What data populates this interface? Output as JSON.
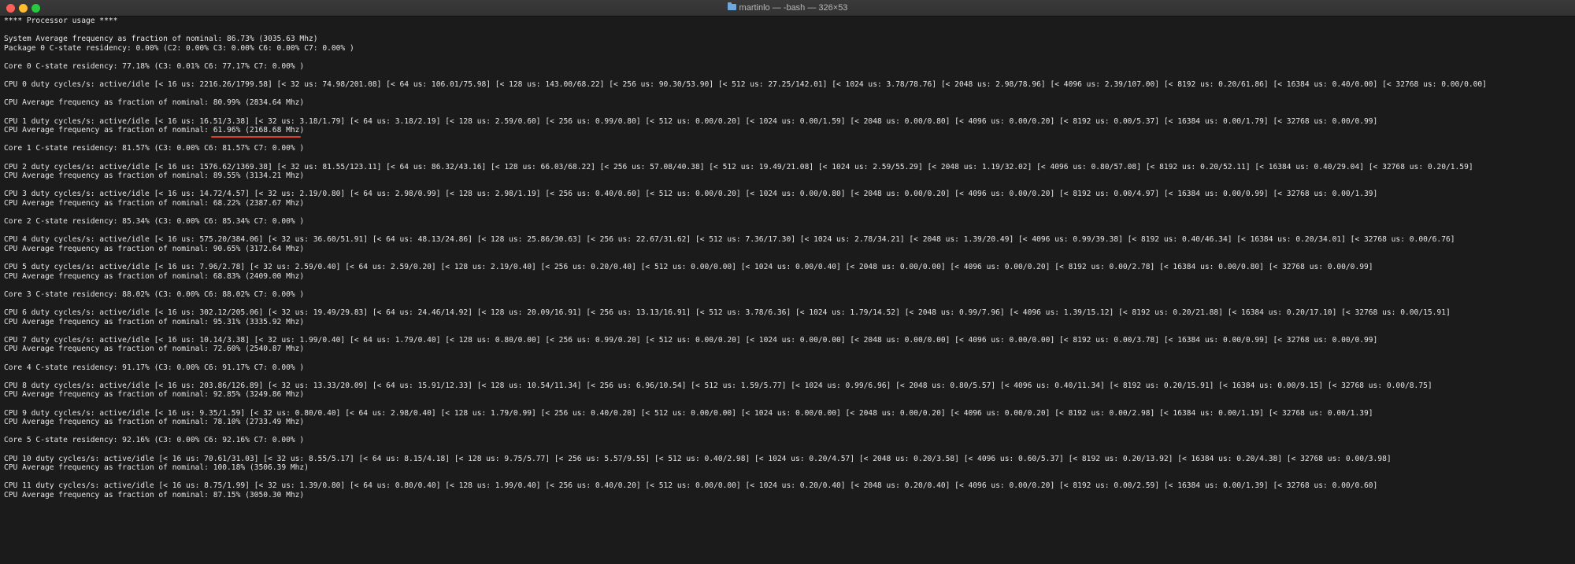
{
  "window": {
    "title": "martinlo — -bash — 326×53"
  },
  "colors": {
    "background": "#1b1b1b",
    "text": "#e6e6e6",
    "annotation": "#e0402a"
  },
  "terminal": {
    "lines": [
      "**** Processor usage ****",
      "",
      "System Average frequency as fraction of nominal: 86.73% (3035.63 Mhz)",
      "Package 0 C-state residency: 0.00% (C2: 0.00% C3: 0.00% C6: 0.00% C7: 0.00% )",
      "",
      "Core 0 C-state residency: 77.18% (C3: 0.01% C6: 77.17% C7: 0.00% )",
      "",
      "CPU 0 duty cycles/s: active/idle [< 16 us: 2216.26/1799.58] [< 32 us: 74.98/201.08] [< 64 us: 106.01/75.98] [< 128 us: 143.00/68.22] [< 256 us: 90.30/53.90] [< 512 us: 27.25/142.01] [< 1024 us: 3.78/78.76] [< 2048 us: 2.98/78.96] [< 4096 us: 2.39/107.00] [< 8192 us: 0.20/61.86] [< 16384 us: 0.40/0.00] [< 32768 us: 0.00/0.00]",
      "",
      "CPU Average frequency as fraction of nominal: 80.99% (2834.64 Mhz)",
      "",
      "CPU 1 duty cycles/s: active/idle [< 16 us: 16.51/3.38] [< 32 us: 3.18/1.79] [< 64 us: 3.18/2.19] [< 128 us: 2.59/0.60] [< 256 us: 0.99/0.80] [< 512 us: 0.00/0.20] [< 1024 us: 0.00/1.59] [< 2048 us: 0.00/0.80] [< 4096 us: 0.00/0.20] [< 8192 us: 0.00/5.37] [< 16384 us: 0.00/1.79] [< 32768 us: 0.00/0.99]",
      "__HIGHLIGHT__",
      "",
      "Core 1 C-state residency: 81.57% (C3: 0.00% C6: 81.57% C7: 0.00% )",
      "",
      "CPU 2 duty cycles/s: active/idle [< 16 us: 1576.62/1369.38] [< 32 us: 81.55/123.11] [< 64 us: 86.32/43.16] [< 128 us: 66.03/68.22] [< 256 us: 57.08/40.38] [< 512 us: 19.49/21.08] [< 1024 us: 2.59/55.29] [< 2048 us: 1.19/32.02] [< 4096 us: 0.80/57.08] [< 8192 us: 0.20/52.11] [< 16384 us: 0.40/29.04] [< 32768 us: 0.20/1.59]",
      "CPU Average frequency as fraction of nominal: 89.55% (3134.21 Mhz)",
      "",
      "CPU 3 duty cycles/s: active/idle [< 16 us: 14.72/4.57] [< 32 us: 2.19/0.80] [< 64 us: 2.98/0.99] [< 128 us: 2.98/1.19] [< 256 us: 0.40/0.60] [< 512 us: 0.00/0.20] [< 1024 us: 0.00/0.80] [< 2048 us: 0.00/0.20] [< 4096 us: 0.00/0.20] [< 8192 us: 0.00/4.97] [< 16384 us: 0.00/0.99] [< 32768 us: 0.00/1.39]",
      "CPU Average frequency as fraction of nominal: 68.22% (2387.67 Mhz)",
      "",
      "Core 2 C-state residency: 85.34% (C3: 0.00% C6: 85.34% C7: 0.00% )",
      "",
      "CPU 4 duty cycles/s: active/idle [< 16 us: 575.20/384.06] [< 32 us: 36.60/51.91] [< 64 us: 48.13/24.86] [< 128 us: 25.86/30.63] [< 256 us: 22.67/31.62] [< 512 us: 7.36/17.30] [< 1024 us: 2.78/34.21] [< 2048 us: 1.39/20.49] [< 4096 us: 0.99/39.38] [< 8192 us: 0.40/46.34] [< 16384 us: 0.20/34.01] [< 32768 us: 0.00/6.76]",
      "CPU Average frequency as fraction of nominal: 90.65% (3172.64 Mhz)",
      "",
      "CPU 5 duty cycles/s: active/idle [< 16 us: 7.96/2.78] [< 32 us: 2.59/0.40] [< 64 us: 2.59/0.20] [< 128 us: 2.19/0.40] [< 256 us: 0.20/0.40] [< 512 us: 0.00/0.00] [< 1024 us: 0.00/0.40] [< 2048 us: 0.00/0.00] [< 4096 us: 0.00/0.20] [< 8192 us: 0.00/2.78] [< 16384 us: 0.00/0.80] [< 32768 us: 0.00/0.99]",
      "CPU Average frequency as fraction of nominal: 68.83% (2409.00 Mhz)",
      "",
      "Core 3 C-state residency: 88.02% (C3: 0.00% C6: 88.02% C7: 0.00% )",
      "",
      "CPU 6 duty cycles/s: active/idle [< 16 us: 302.12/205.06] [< 32 us: 19.49/29.83] [< 64 us: 24.46/14.92] [< 128 us: 20.09/16.91] [< 256 us: 13.13/16.91] [< 512 us: 3.78/6.36] [< 1024 us: 1.79/14.52] [< 2048 us: 0.99/7.96] [< 4096 us: 1.39/15.12] [< 8192 us: 0.20/21.88] [< 16384 us: 0.20/17.10] [< 32768 us: 0.00/15.91]",
      "CPU Average frequency as fraction of nominal: 95.31% (3335.92 Mhz)",
      "",
      "CPU 7 duty cycles/s: active/idle [< 16 us: 10.14/3.38] [< 32 us: 1.99/0.40] [< 64 us: 1.79/0.40] [< 128 us: 0.80/0.00] [< 256 us: 0.99/0.20] [< 512 us: 0.00/0.20] [< 1024 us: 0.00/0.00] [< 2048 us: 0.00/0.00] [< 4096 us: 0.00/0.00] [< 8192 us: 0.00/3.78] [< 16384 us: 0.00/0.99] [< 32768 us: 0.00/0.99]",
      "CPU Average frequency as fraction of nominal: 72.60% (2540.87 Mhz)",
      "",
      "Core 4 C-state residency: 91.17% (C3: 0.00% C6: 91.17% C7: 0.00% )",
      "",
      "CPU 8 duty cycles/s: active/idle [< 16 us: 203.86/126.89] [< 32 us: 13.33/20.09] [< 64 us: 15.91/12.33] [< 128 us: 10.54/11.34] [< 256 us: 6.96/10.54] [< 512 us: 1.59/5.77] [< 1024 us: 0.99/6.96] [< 2048 us: 0.80/5.57] [< 4096 us: 0.40/11.34] [< 8192 us: 0.20/15.91] [< 16384 us: 0.00/9.15] [< 32768 us: 0.00/8.75]",
      "CPU Average frequency as fraction of nominal: 92.85% (3249.86 Mhz)",
      "",
      "CPU 9 duty cycles/s: active/idle [< 16 us: 9.35/1.59] [< 32 us: 0.80/0.40] [< 64 us: 2.98/0.40] [< 128 us: 1.79/0.99] [< 256 us: 0.40/0.20] [< 512 us: 0.00/0.00] [< 1024 us: 0.00/0.00] [< 2048 us: 0.00/0.20] [< 4096 us: 0.00/0.20] [< 8192 us: 0.00/2.98] [< 16384 us: 0.00/1.19] [< 32768 us: 0.00/1.39]",
      "CPU Average frequency as fraction of nominal: 78.10% (2733.49 Mhz)",
      "",
      "Core 5 C-state residency: 92.16% (C3: 0.00% C6: 92.16% C7: 0.00% )",
      "",
      "CPU 10 duty cycles/s: active/idle [< 16 us: 70.61/31.03] [< 32 us: 8.55/5.17] [< 64 us: 8.15/4.18] [< 128 us: 9.75/5.77] [< 256 us: 5.57/9.55] [< 512 us: 0.40/2.98] [< 1024 us: 0.20/4.57] [< 2048 us: 0.20/3.58] [< 4096 us: 0.60/5.37] [< 8192 us: 0.20/13.92] [< 16384 us: 0.20/4.38] [< 32768 us: 0.00/3.98]",
      "CPU Average frequency as fraction of nominal: 100.18% (3506.39 Mhz)",
      "",
      "CPU 11 duty cycles/s: active/idle [< 16 us: 8.75/1.99] [< 32 us: 1.39/0.80] [< 64 us: 0.80/0.40] [< 128 us: 1.99/0.40] [< 256 us: 0.40/0.20] [< 512 us: 0.00/0.00] [< 1024 us: 0.20/0.40] [< 2048 us: 0.20/0.40] [< 4096 us: 0.00/0.20] [< 8192 us: 0.00/2.59] [< 16384 us: 0.00/1.39] [< 32768 us: 0.00/0.60]",
      "CPU Average frequency as fraction of nominal: 87.15% (3050.30 Mhz)"
    ],
    "highlight_line": {
      "prefix": "CPU Average frequency as fraction of nominal: ",
      "value": "61.96% (2168.68 Mhz)"
    }
  }
}
